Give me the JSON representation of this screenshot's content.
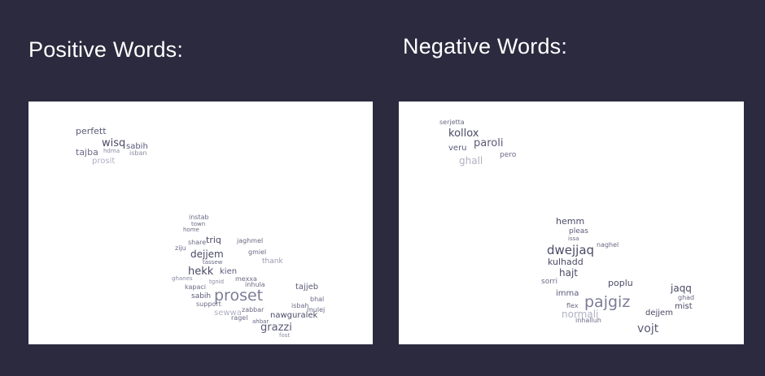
{
  "headings": {
    "positive": "Positive Words:",
    "negative": "Negative Words:"
  },
  "colors": {
    "background": "#2b2a3e",
    "panel": "#ffffff",
    "word_dark": "#4a4a66",
    "word_mid": "#7c7c96",
    "word_light": "#b9b9cc"
  },
  "positive_words": [
    "perfett",
    "wisq",
    "sabih",
    "tajba",
    "hdma",
    "isban",
    "prosit",
    "instab",
    "town",
    "home",
    "triq",
    "jaghmel",
    "dejjem",
    "gmiel",
    "thank",
    "hekk",
    "kien",
    "share",
    "ziju",
    "tassew",
    "mexxa",
    "proset",
    "tajjeb",
    "sabih",
    "support",
    "zabbar",
    "nawguralek",
    "grazzi",
    "sewwa",
    "bhal",
    "isbah",
    "mulej",
    "ragel",
    "ahbar",
    "kapaci",
    "inhula",
    "tgnid",
    "ghanes",
    "fost"
  ],
  "negative_words": [
    "serjetta",
    "kollox",
    "paroli",
    "veru",
    "ghall",
    "pero",
    "hemm",
    "pleas",
    "issa",
    "dwejjaq",
    "naghel",
    "kulhadd",
    "hajt",
    "poplu",
    "imma",
    "sorri",
    "jaqq",
    "pajgiz",
    "dejjem",
    "normali",
    "mist",
    "vojt",
    "flex",
    "inhalluh",
    "ghad"
  ]
}
